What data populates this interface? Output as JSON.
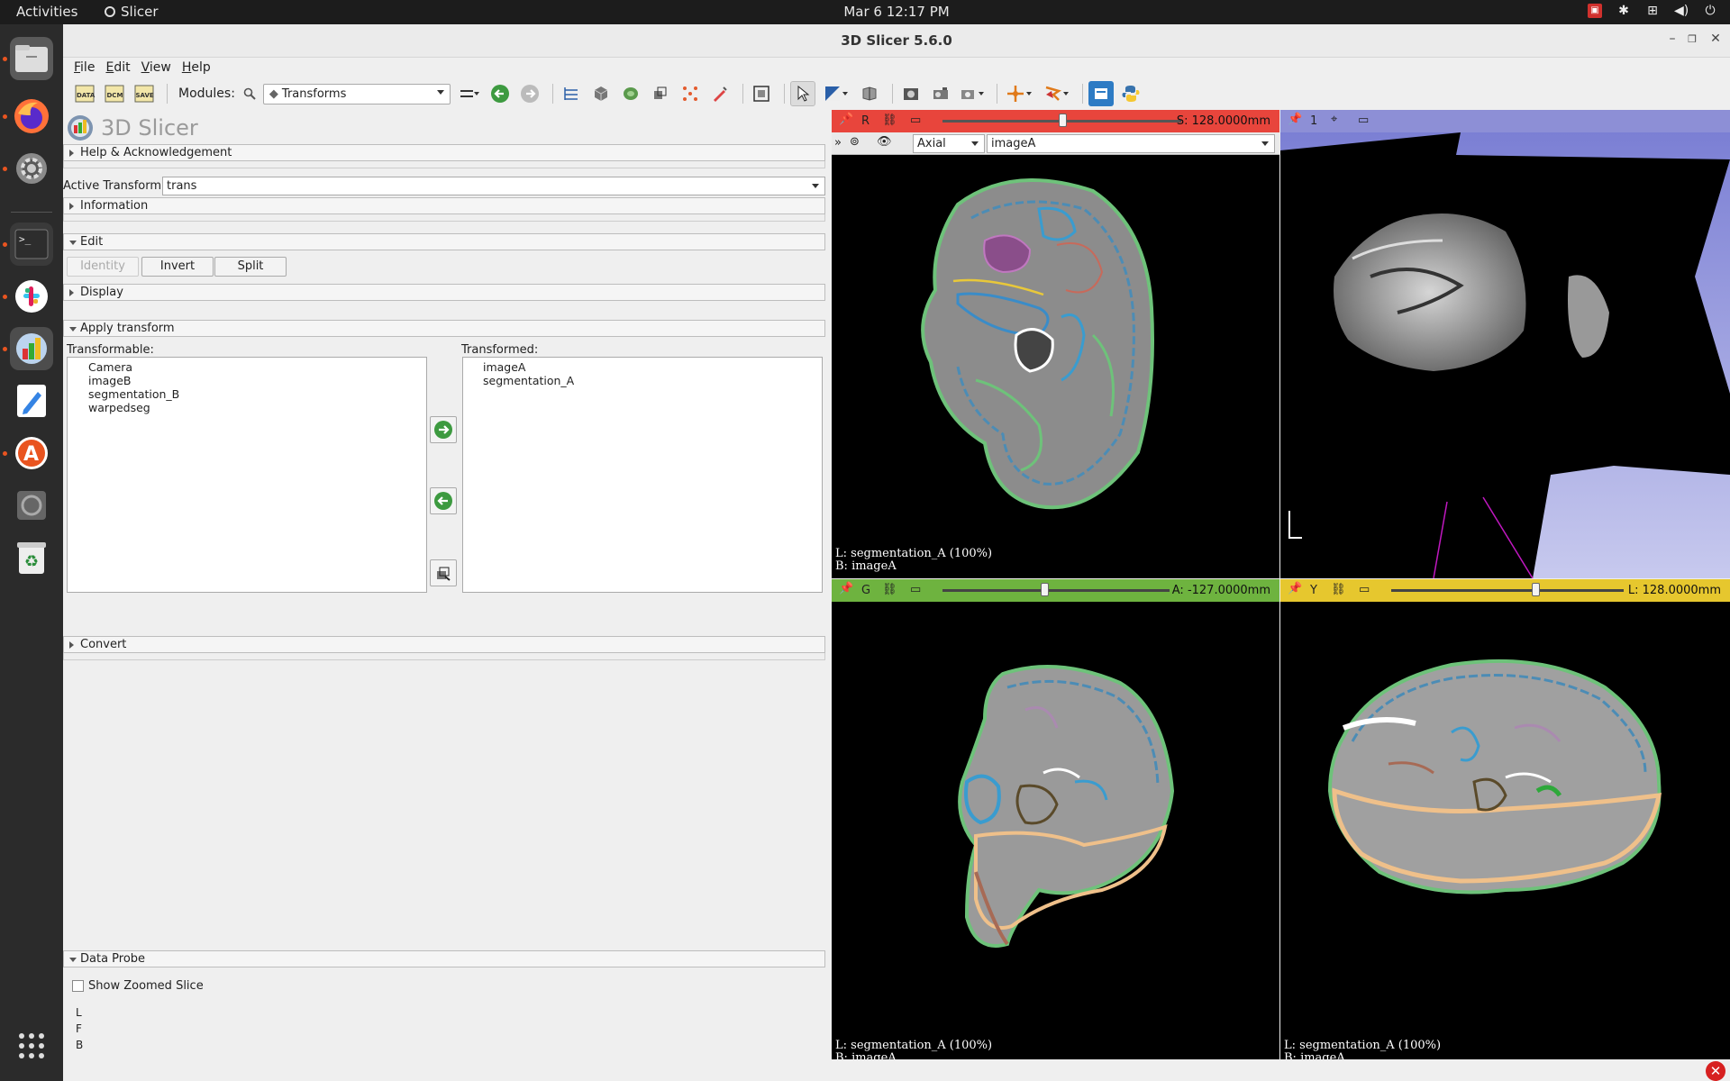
{
  "topbar": {
    "activities": "Activities",
    "app_name": "Slicer",
    "clock": "Mar 6  12:17 PM"
  },
  "dock": {
    "items": [
      "files-icon",
      "firefox-icon",
      "settings-icon",
      "terminal-icon",
      "slack-icon",
      "slicer-icon",
      "text-editor-icon",
      "software-center-icon",
      "disc-icon",
      "trash-icon",
      "app-grid-icon"
    ]
  },
  "window": {
    "title": "3D Slicer 5.6.0"
  },
  "menu": [
    "File",
    "Edit",
    "View",
    "Help"
  ],
  "toolbar": {
    "modules_label": "Modules:",
    "module_selected": "Transforms",
    "data_label": "DATA",
    "dcm_label": "DCM",
    "save_label": "SAVE"
  },
  "panel": {
    "logo_text": "3D Slicer",
    "sections": {
      "help": "Help & Acknowledgement",
      "information": "Information",
      "edit": "Edit",
      "display": "Display",
      "apply": "Apply transform",
      "convert": "Convert",
      "probe": "Data Probe"
    },
    "active_transform_label": "Active Transform:",
    "active_transform_value": "trans",
    "edit_buttons": {
      "identity": "Identity",
      "invert": "Invert",
      "split": "Split"
    },
    "transformable_label": "Transformable:",
    "transformed_label": "Transformed:",
    "transformable": [
      "Camera",
      "imageB",
      "segmentation_B",
      "warpedseg"
    ],
    "transformed": [
      "imageA",
      "segmentation_A"
    ],
    "probe": {
      "show_zoomed": "Show Zoomed Slice",
      "l": "L",
      "f": "F",
      "b": "B"
    }
  },
  "views": {
    "red": {
      "letter": "R",
      "offset": "S: 128.0000mm",
      "orientation": "Axial",
      "volume": "imageA",
      "fg_label": "L: segmentation_A (100%)",
      "bg_label": "B: imageA",
      "slider_fraction": 0.5,
      "color": "#e8453c"
    },
    "threed": {
      "number": "1",
      "color": "#8d8fd6",
      "orientation_letter": "L"
    },
    "green": {
      "letter": "G",
      "offset": "A: -127.0000mm",
      "fg_label": "L: segmentation_A (100%)",
      "bg_label": "B: imageA",
      "slider_fraction": 0.45,
      "color": "#6eb33f"
    },
    "yellow": {
      "letter": "Y",
      "offset": "L: 128.0000mm",
      "fg_label": "L: segmentation_A (100%)",
      "bg_label": "B: imageA",
      "slider_fraction": 0.62,
      "color": "#e6c72e"
    }
  }
}
